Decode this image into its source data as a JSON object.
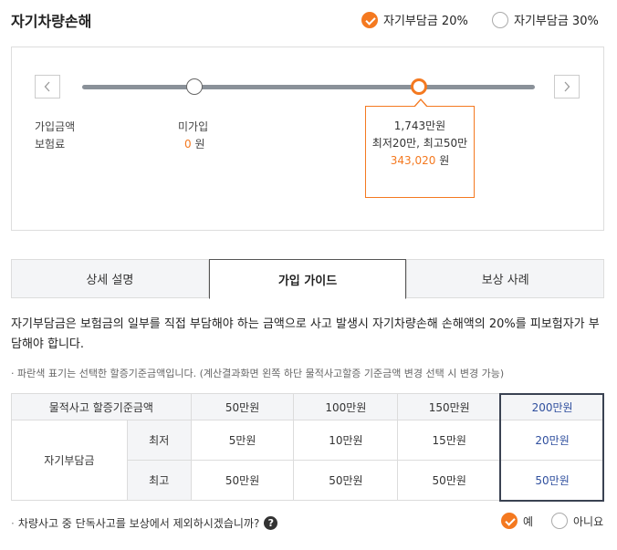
{
  "header": {
    "title": "자기차량손해",
    "options": [
      {
        "label": "자기부담금 20%",
        "selected": true
      },
      {
        "label": "자기부담금 30%",
        "selected": false
      }
    ]
  },
  "slider": {
    "prev_icon": "chevron-left-icon",
    "next_icon": "chevron-right-icon",
    "row_label_1": "가입금액",
    "row_label_2": "보험료",
    "left_amount_label": "미가입",
    "left_premium_value": "0",
    "won": "원",
    "selected": {
      "amount": "1,743만원",
      "range": "최저20만, 최고50만",
      "premium": "343,020",
      "won": "원"
    },
    "accent_color": "#f47920"
  },
  "tabs": [
    "상세 설명",
    "가입 가이드",
    "보상 사례"
  ],
  "active_tab": "가입 가이드",
  "guide": {
    "description": "자기부담금은 보험금의 일부를 직접 부담해야 하는 금액으로 사고 발생시 자기차량손해 손해액의 20%를 피보험자가 부담해야 합니다.",
    "note": "· 파란색 표기는 선택한 할증기준금액입니다. (계산결과화면 왼쪽 하단 물적사고할증 기준금액 변경 선택 시 변경 가능)"
  },
  "table": {
    "header_label": "물적사고 할증기준금액",
    "columns": [
      "50만원",
      "100만원",
      "150만원",
      "200만원"
    ],
    "group_label": "자기부담금",
    "rows": [
      {
        "label": "최저",
        "values": [
          "5만원",
          "10만원",
          "15만원",
          "20만원"
        ]
      },
      {
        "label": "최고",
        "values": [
          "50만원",
          "50만원",
          "50만원",
          "50만원"
        ]
      }
    ],
    "highlight_color": "#2f4f9e"
  },
  "question": {
    "text": "차량사고 중 단독사고를 보상에서 제외하시겠습니까?",
    "help_icon": "question-circle-icon",
    "yes": "예",
    "no": "아니요",
    "selected": "예"
  }
}
